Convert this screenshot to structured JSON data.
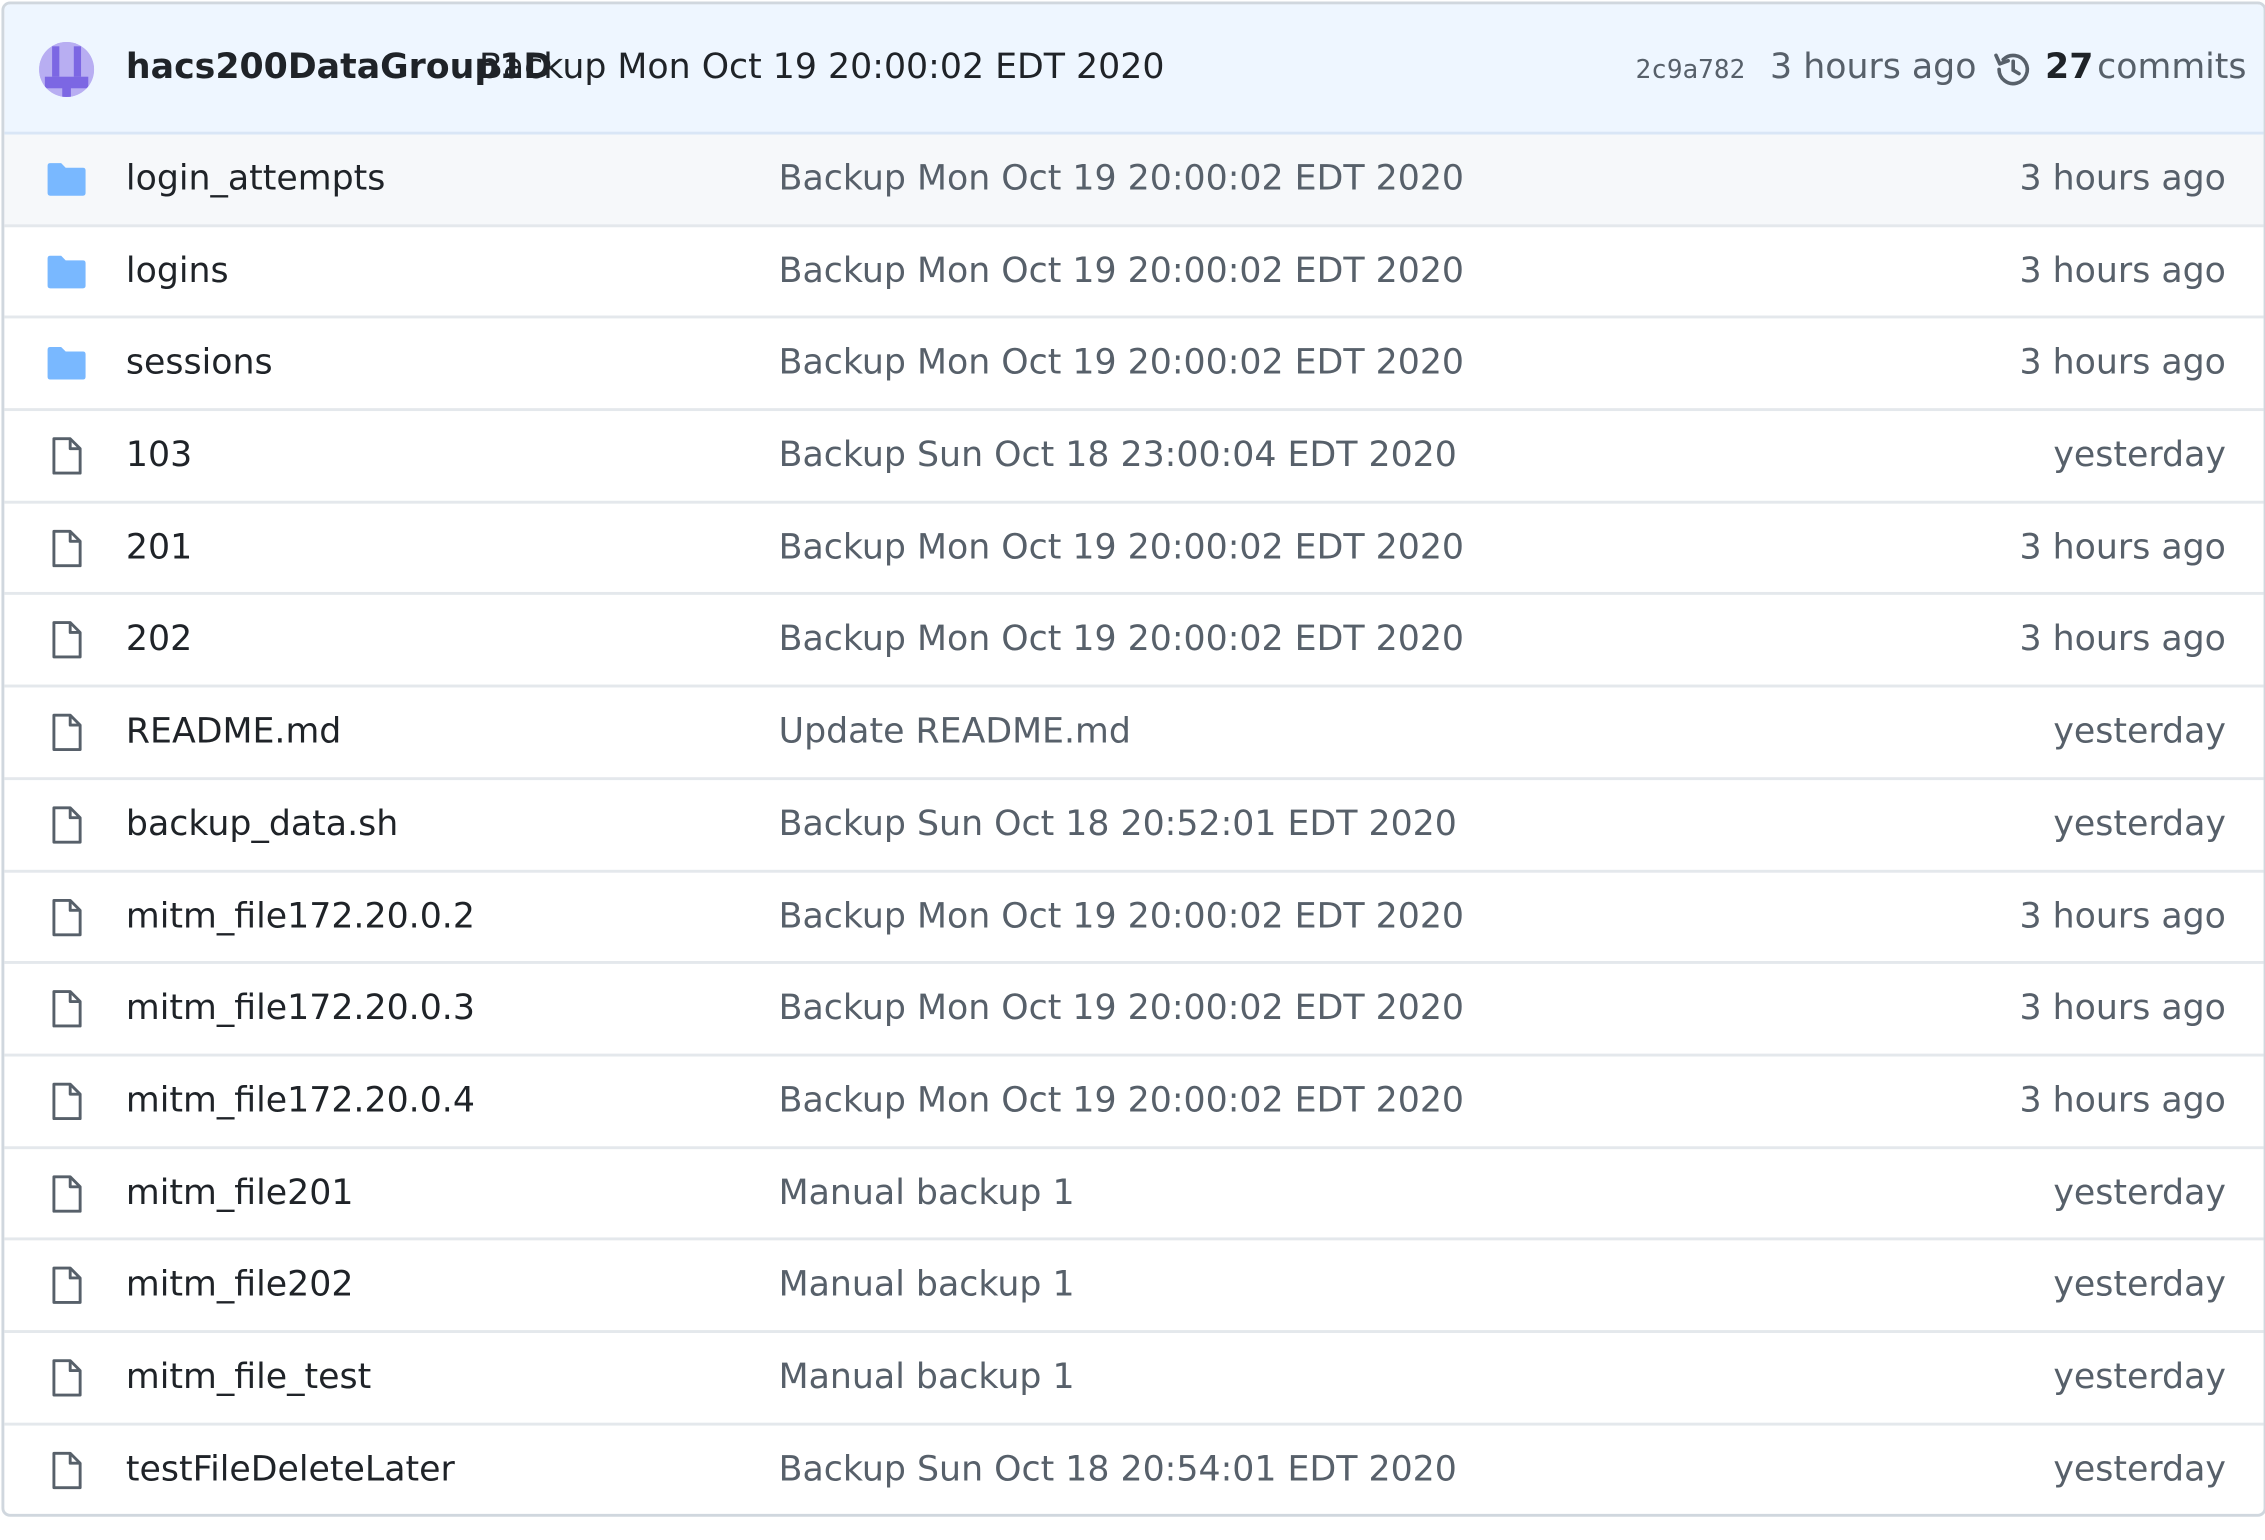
{
  "latest_commit": {
    "author": "hacs200DataGroup1D",
    "message": "Backup Mon Oct 19 20:00:02 EDT 2020",
    "sha": "2c9a782",
    "age": "3 hours ago",
    "commit_count": "27",
    "commit_count_label": "commits",
    "history_icon": "history-icon",
    "avatar_color": "#b8aef2"
  },
  "files": [
    {
      "type": "folder",
      "icon": "folder-icon",
      "name": "login_attempts",
      "commit": "Backup Mon Oct 19 20:00:02 EDT 2020",
      "age": "3 hours ago"
    },
    {
      "type": "folder",
      "icon": "folder-icon",
      "name": "logins",
      "commit": "Backup Mon Oct 19 20:00:02 EDT 2020",
      "age": "3 hours ago"
    },
    {
      "type": "folder",
      "icon": "folder-icon",
      "name": "sessions",
      "commit": "Backup Mon Oct 19 20:00:02 EDT 2020",
      "age": "3 hours ago"
    },
    {
      "type": "file",
      "icon": "file-icon",
      "name": "103",
      "commit": "Backup Sun Oct 18 23:00:04 EDT 2020",
      "age": "yesterday"
    },
    {
      "type": "file",
      "icon": "file-icon",
      "name": "201",
      "commit": "Backup Mon Oct 19 20:00:02 EDT 2020",
      "age": "3 hours ago"
    },
    {
      "type": "file",
      "icon": "file-icon",
      "name": "202",
      "commit": "Backup Mon Oct 19 20:00:02 EDT 2020",
      "age": "3 hours ago"
    },
    {
      "type": "file",
      "icon": "file-icon",
      "name": "README.md",
      "commit": "Update README.md",
      "age": "yesterday"
    },
    {
      "type": "file",
      "icon": "file-icon",
      "name": "backup_data.sh",
      "commit": "Backup Sun Oct 18 20:52:01 EDT 2020",
      "age": "yesterday"
    },
    {
      "type": "file",
      "icon": "file-icon",
      "name": "mitm_file172.20.0.2",
      "commit": "Backup Mon Oct 19 20:00:02 EDT 2020",
      "age": "3 hours ago"
    },
    {
      "type": "file",
      "icon": "file-icon",
      "name": "mitm_file172.20.0.3",
      "commit": "Backup Mon Oct 19 20:00:02 EDT 2020",
      "age": "3 hours ago"
    },
    {
      "type": "file",
      "icon": "file-icon",
      "name": "mitm_file172.20.0.4",
      "commit": "Backup Mon Oct 19 20:00:02 EDT 2020",
      "age": "3 hours ago"
    },
    {
      "type": "file",
      "icon": "file-icon",
      "name": "mitm_file201",
      "commit": "Manual backup 1",
      "age": "yesterday"
    },
    {
      "type": "file",
      "icon": "file-icon",
      "name": "mitm_file202",
      "commit": "Manual backup 1",
      "age": "yesterday"
    },
    {
      "type": "file",
      "icon": "file-icon",
      "name": "mitm_file_test",
      "commit": "Manual backup 1",
      "age": "yesterday"
    },
    {
      "type": "file",
      "icon": "file-icon",
      "name": "testFileDeleteLater",
      "commit": "Backup Sun Oct 18 20:54:01 EDT 2020",
      "age": "yesterday"
    }
  ],
  "colors": {
    "folder": "#79b8ff",
    "file_outline": "#57606a",
    "header_bg": "#eef6ff"
  }
}
